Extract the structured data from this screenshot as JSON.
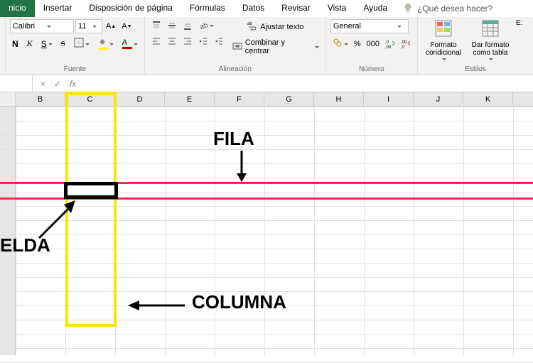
{
  "tabs": {
    "inicio": "nicio",
    "insertar": "Insertar",
    "disposicion": "Disposición de página",
    "formulas": "Fórmulas",
    "datos": "Datos",
    "revisar": "Revisar",
    "vista": "Vista",
    "ayuda": "Ayuda",
    "tellme": "¿Qué desea hacer?"
  },
  "font": {
    "name": "Calibri",
    "size": "11",
    "bold": "N",
    "italic": "K",
    "underline": "S",
    "strike": "S",
    "letterA": "A"
  },
  "align": {
    "wrap": "Ajustar texto",
    "merge": "Combinar y centrar"
  },
  "number": {
    "format": "General",
    "pct": "%",
    "000": "000"
  },
  "styles": {
    "cond": "Formato condicional",
    "table": "Dar formato como tabla",
    "cell_partial": "E:"
  },
  "groups": {
    "fuente": "Fuente",
    "alineacion": "Alineación",
    "numero": "Número",
    "estilos": "Estilos"
  },
  "fx": {
    "label": "fx",
    "x": "×",
    "check": "✓"
  },
  "columns": [
    "B",
    "C",
    "D",
    "E",
    "F",
    "G",
    "H",
    "I",
    "J",
    "K"
  ],
  "anno": {
    "fila": "FILA",
    "columna": "COLUMNA",
    "celda": "ELDA"
  }
}
